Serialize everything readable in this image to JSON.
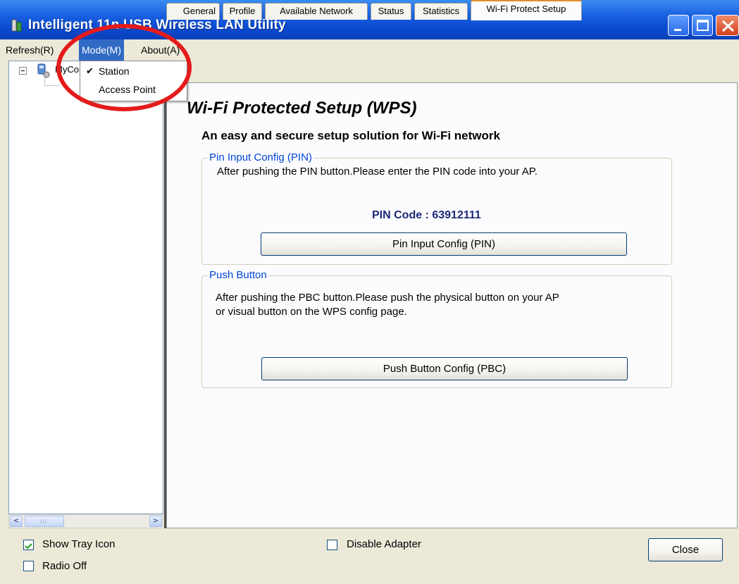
{
  "window": {
    "title": "Intelligent 11n USB Wireless LAN Utility",
    "icon": "wireless-app-icon",
    "controls": [
      "minimize-icon",
      "maximize-icon",
      "close-icon"
    ]
  },
  "menubar": {
    "items": [
      {
        "label": "Refresh(R)"
      },
      {
        "label": "Mode(M)",
        "active": true
      },
      {
        "label": "About(A)"
      }
    ]
  },
  "mode_menu": {
    "items": [
      {
        "label": "Station",
        "checked": true
      },
      {
        "label": "Access Point",
        "checked": false
      }
    ]
  },
  "tree": {
    "root_label": "MyComputer",
    "expander": "collapse",
    "icon": "computer-network-icon"
  },
  "tabs": [
    {
      "label": "General"
    },
    {
      "label": "Profile"
    },
    {
      "label": "Available Network"
    },
    {
      "label": "Status"
    },
    {
      "label": "Statistics"
    },
    {
      "label": "Wi-Fi Protect Setup",
      "active": true
    }
  ],
  "wps": {
    "title": "Wi-Fi Protected Setup (WPS)",
    "subtitle": "An easy and secure setup solution for Wi-Fi network",
    "pin_group": {
      "legend": "Pin Input Config (PIN)",
      "instruction": "After pushing the PIN button.Please enter the PIN code into your AP.",
      "pin_label": "PIN Code : ",
      "pin_value": "63912111",
      "button_label": "Pin Input Config (PIN)"
    },
    "pbc_group": {
      "legend": "Push Button",
      "instruction_line1": "After pushing the PBC button.Please push the physical button on your AP",
      "instruction_line2": "or visual button on the WPS config page.",
      "button_label": "Push Button Config (PBC)"
    }
  },
  "footer": {
    "show_tray_icon": {
      "label": "Show Tray Icon",
      "checked": true
    },
    "radio_off": {
      "label": "Radio Off",
      "checked": false
    },
    "disable_adapter": {
      "label": "Disable Adapter",
      "checked": false
    },
    "close_label": "Close"
  },
  "colors": {
    "title_bar": "#0b4bd0",
    "menu_highlight": "#316ac5",
    "group_legend": "#0046d5",
    "pin_code": "#1c2a7a",
    "annotation_ring": "#e41b1b",
    "active_tab_accent": "#e68b2c"
  }
}
